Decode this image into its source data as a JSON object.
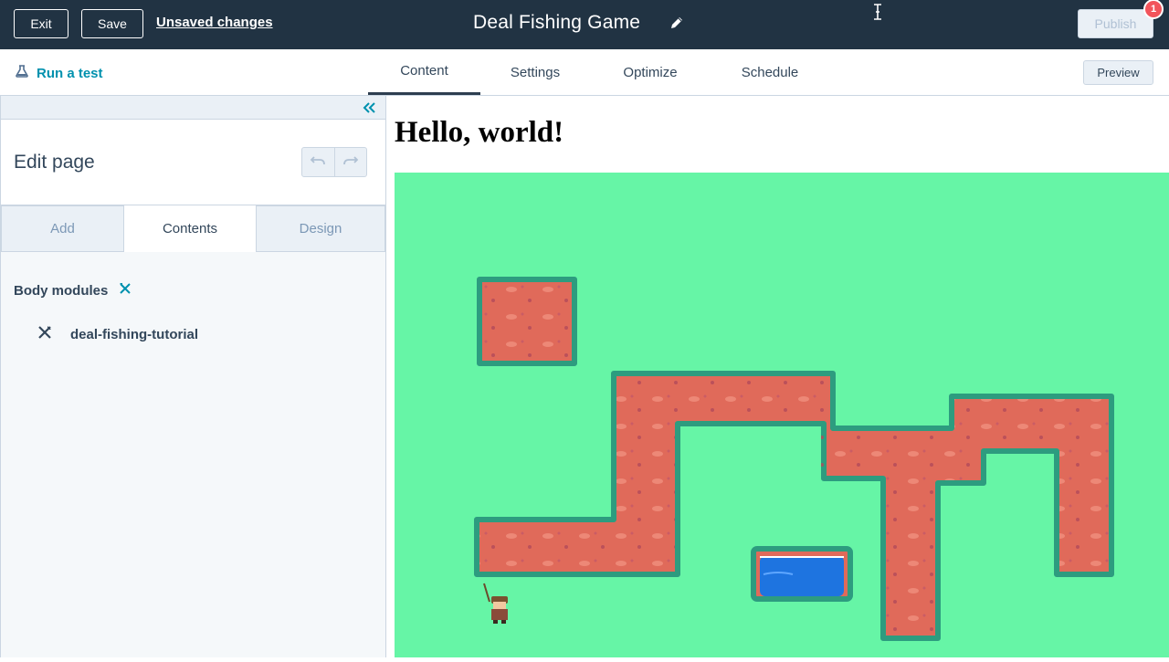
{
  "topbar": {
    "exit_label": "Exit",
    "save_label": "Save",
    "unsaved_label": "Unsaved changes",
    "title": "Deal Fishing Game",
    "publish_label": "Publish",
    "notification_count": "1"
  },
  "nav": {
    "run_test_label": "Run a test",
    "tabs": [
      {
        "label": "Content",
        "active": true
      },
      {
        "label": "Settings",
        "active": false
      },
      {
        "label": "Optimize",
        "active": false
      },
      {
        "label": "Schedule",
        "active": false
      }
    ],
    "preview_label": "Preview"
  },
  "sidebar": {
    "title": "Edit page",
    "tabs": [
      {
        "label": "Add",
        "active": false
      },
      {
        "label": "Contents",
        "active": true
      },
      {
        "label": "Design",
        "active": false
      }
    ],
    "section_title": "Body modules",
    "modules": [
      {
        "label": "deal-fishing-tutorial"
      }
    ]
  },
  "content": {
    "heading": "Hello, world!"
  },
  "colors": {
    "topbar_bg": "#213343",
    "accent": "#0091ae",
    "game_grass": "#66f5a6",
    "game_path": "#e06a5a",
    "game_water": "#1e74e0",
    "badge": "#f2545b"
  },
  "icons": [
    "pencil-icon",
    "text-cursor-icon",
    "flask-icon",
    "collapse-chevrons-icon",
    "undo-icon",
    "redo-icon",
    "tools-icon"
  ]
}
